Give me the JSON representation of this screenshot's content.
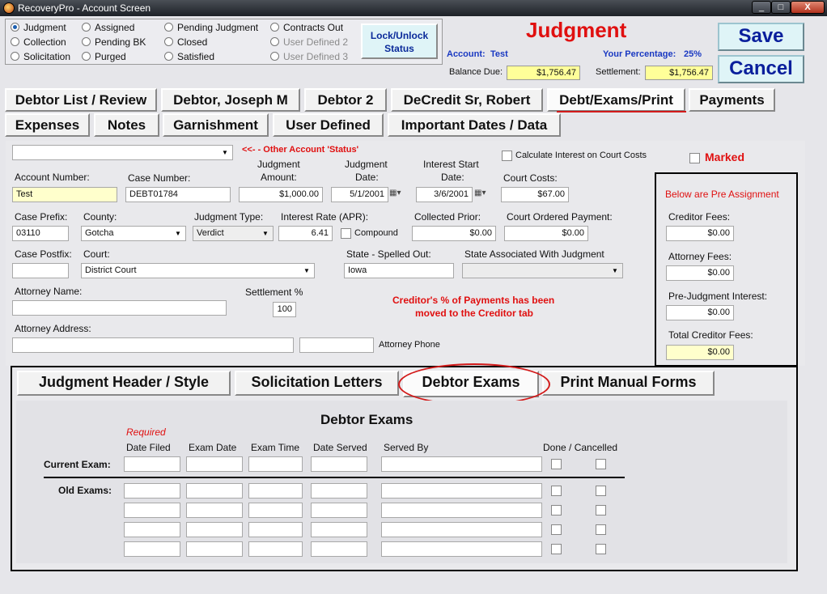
{
  "window": {
    "title": "RecoveryPro - Account Screen",
    "min": "_",
    "max": "□",
    "close": "X"
  },
  "status_options": [
    {
      "label": "Judgment",
      "selected": true,
      "disabled": false
    },
    {
      "label": "Collection",
      "selected": false,
      "disabled": false
    },
    {
      "label": "Solicitation",
      "selected": false,
      "disabled": false
    },
    {
      "label": "Assigned",
      "selected": false,
      "disabled": false
    },
    {
      "label": "Pending BK",
      "selected": false,
      "disabled": false
    },
    {
      "label": "Purged",
      "selected": false,
      "disabled": false
    },
    {
      "label": "Pending Judgment",
      "selected": false,
      "disabled": false
    },
    {
      "label": "Closed",
      "selected": false,
      "disabled": false
    },
    {
      "label": "Satisfied",
      "selected": false,
      "disabled": false
    },
    {
      "label": "Contracts Out",
      "selected": false,
      "disabled": false
    },
    {
      "label": "User Defined 2",
      "selected": false,
      "disabled": true
    },
    {
      "label": "User Defined 3",
      "selected": false,
      "disabled": true
    }
  ],
  "header": {
    "lock_line1": "Lock/Unlock",
    "lock_line2": "Status",
    "title": "Judgment",
    "account_label": "Account:",
    "account_value": "Test",
    "percentage_label": "Your Percentage:",
    "percentage_value": "25%",
    "balance_label": "Balance Due:",
    "balance_value": "$1,756.47",
    "settlement_label": "Settlement:",
    "settlement_value": "$1,756.47",
    "save": "Save",
    "cancel": "Cancel"
  },
  "tabs_row1": [
    "Debtor List / Review",
    "Debtor, Joseph M",
    "Debtor 2",
    "DeCredit Sr, Robert",
    "Debt/Exams/Print",
    "Payments"
  ],
  "tabs_row2": [
    "Expenses",
    "Notes",
    "Garnishment",
    "User Defined",
    "Important Dates / Data"
  ],
  "form": {
    "other_status_note": "<<- - Other Account 'Status'",
    "calc_interest": "Calculate Interest on Court Costs",
    "marked": "Marked",
    "account_number_label": "Account Number:",
    "account_number": "Test",
    "case_number_label": "Case Number:",
    "case_number": "DEBT01784",
    "judgment_amount_label1": "Judgment",
    "judgment_amount_label2": "Amount:",
    "judgment_amount": "$1,000.00",
    "judgment_date_label1": "Judgment",
    "judgment_date_label2": "Date:",
    "judgment_date": "5/1/2001",
    "interest_start_label1": "Interest Start",
    "interest_start_label2": "Date:",
    "interest_start": "3/6/2001",
    "court_costs_label": "Court Costs:",
    "court_costs": "$67.00",
    "case_prefix_label": "Case Prefix:",
    "case_prefix": "03110",
    "county_label": "County:",
    "county": "Gotcha",
    "judgment_type_label": "Judgment Type:",
    "judgment_type": "Verdict",
    "interest_rate_label": "Interest Rate (APR):",
    "interest_rate": "6.41",
    "compound": "Compound",
    "collected_prior_label": "Collected  Prior:",
    "collected_prior": "$0.00",
    "court_ordered_label": "Court Ordered Payment:",
    "court_ordered": "$0.00",
    "case_postfix_label": "Case Postfix:",
    "court_label": "Court:",
    "court": "District Court",
    "state_spelled_label": "State - Spelled Out:",
    "state_spelled": "Iowa",
    "state_assoc_label": "State Associated With Judgment",
    "attorney_name_label": "Attorney Name:",
    "settlement_pct_label": "Settlement %",
    "settlement_pct": "100",
    "creditor_note1": "Creditor's % of Payments has been",
    "creditor_note2": "moved to the Creditor tab",
    "attorney_address_label": "Attorney Address:",
    "attorney_phone_label": "Attorney Phone"
  },
  "right_panel": {
    "title": "Below are Pre Assignment",
    "creditor_fees_label": "Creditor Fees:",
    "creditor_fees": "$0.00",
    "attorney_fees_label": "Attorney Fees:",
    "attorney_fees": "$0.00",
    "prejudgment_label": "Pre-Judgment Interest:",
    "prejudgment": "$0.00",
    "total_label": "Total Creditor Fees:",
    "total": "$0.00"
  },
  "subtabs": [
    "Judgment Header / Style",
    "Solicitation Letters",
    "Debtor Exams",
    "Print Manual Forms"
  ],
  "exams": {
    "title": "Debtor Exams",
    "required": "Required",
    "col_date_filed": "Date Filed",
    "col_exam_date": "Exam Date",
    "col_exam_time": "Exam Time",
    "col_date_served": "Date Served",
    "col_served_by": "Served By",
    "col_done": "Done / Cancelled",
    "current_label": "Current Exam:",
    "old_label": "Old Exams:"
  }
}
